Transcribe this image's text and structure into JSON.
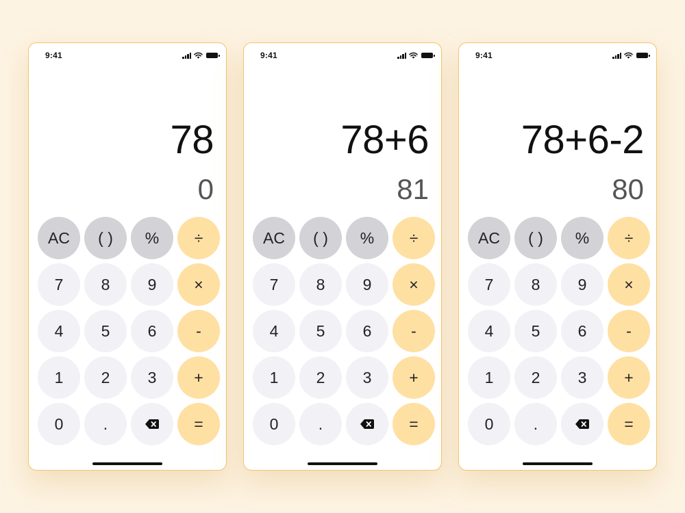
{
  "screens": [
    {
      "time": "9:41",
      "expression": "78",
      "result": "0",
      "keys": [
        "AC",
        "( )",
        "%",
        "÷",
        "7",
        "8",
        "9",
        "×",
        "4",
        "5",
        "6",
        "-",
        "1",
        "2",
        "3",
        "+",
        "0",
        ".",
        "",
        "="
      ]
    },
    {
      "time": "9:41",
      "expression": "78+6",
      "result": "81",
      "keys": [
        "AC",
        "( )",
        "%",
        "÷",
        "7",
        "8",
        "9",
        "×",
        "4",
        "5",
        "6",
        "-",
        "1",
        "2",
        "3",
        "+",
        "0",
        ".",
        "",
        "="
      ]
    },
    {
      "time": "9:41",
      "expression": "78+6-2",
      "result": "80",
      "keys": [
        "AC",
        "( )",
        "%",
        "÷",
        "7",
        "8",
        "9",
        "×",
        "4",
        "5",
        "6",
        "-",
        "1",
        "2",
        "3",
        "+",
        "0",
        ".",
        "",
        "="
      ]
    }
  ],
  "icons": {
    "backspace": "backspace-icon",
    "signal": "signal-icon",
    "wifi": "wifi-icon",
    "battery": "battery-icon"
  },
  "colors": {
    "background": "#fdf3e2",
    "phone_border": "#f2c56b",
    "key_digit": "#f1f1f6",
    "key_function": "#d2d2d7",
    "key_operator": "#ffe0a3"
  }
}
